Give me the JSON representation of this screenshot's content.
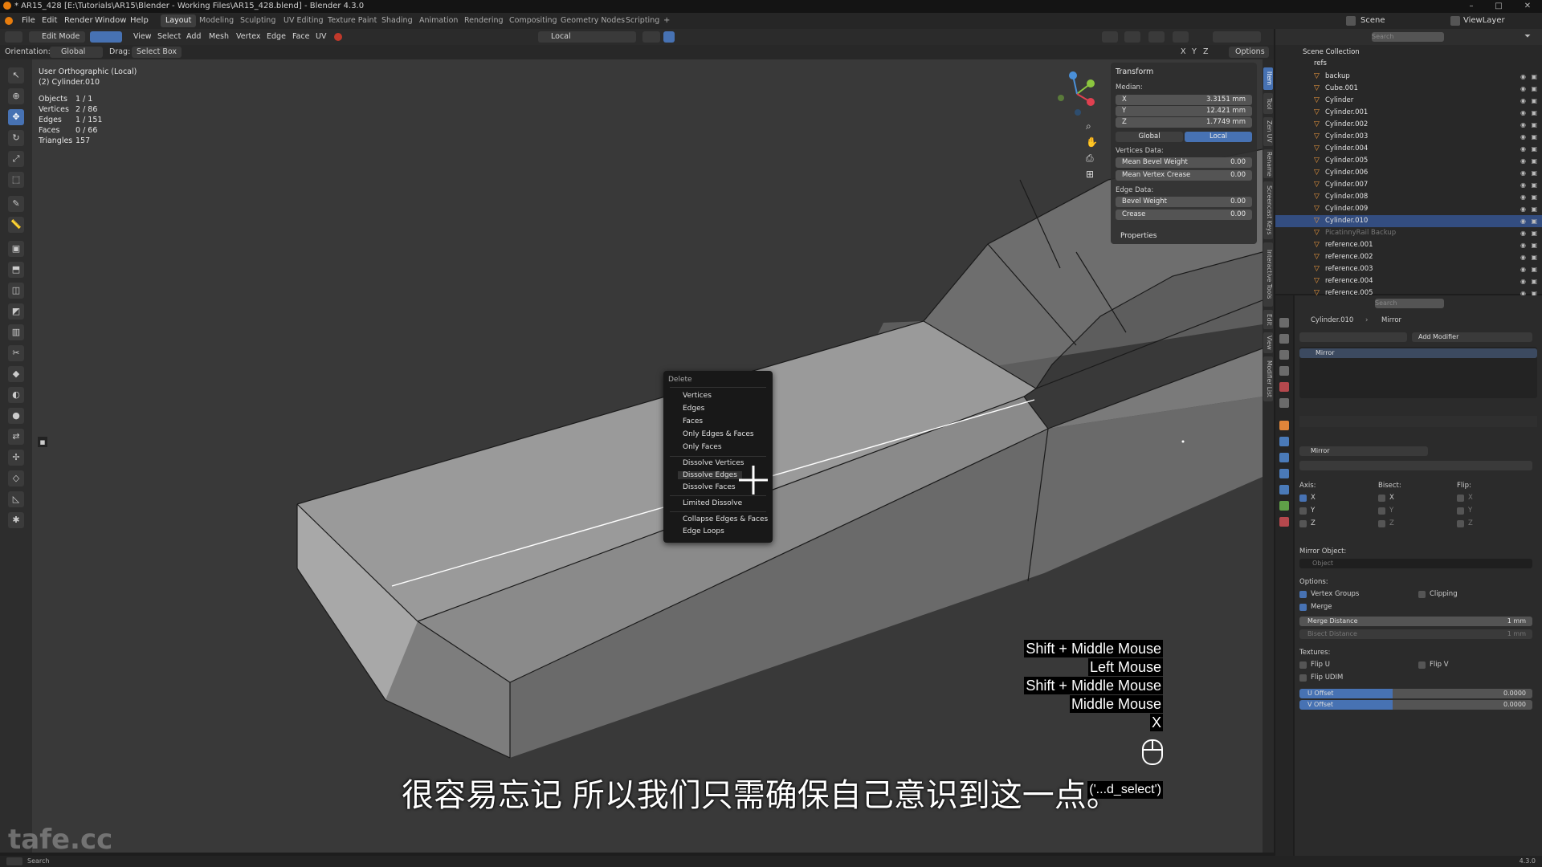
{
  "window": {
    "title": "* AR15_428 [E:\\Tutorials\\AR15\\Blender - Working Files\\AR15_428.blend] - Blender 4.3.0",
    "minimize": "–",
    "maximize": "□",
    "close": "✕"
  },
  "menu": {
    "items": [
      "File",
      "Edit",
      "Render",
      "Window",
      "Help"
    ],
    "workspaces": [
      "Layout",
      "Modeling",
      "Sculpting",
      "UV Editing",
      "Texture Paint",
      "Shading",
      "Animation",
      "Rendering",
      "Compositing",
      "Geometry Nodes",
      "Scripting"
    ],
    "active_workspace": "Layout",
    "add_workspace": "+",
    "scene_label": "Scene",
    "viewlayer_label": "ViewLayer"
  },
  "viewport_header": {
    "mode": "Edit Mode",
    "items": [
      "View",
      "Select",
      "Add",
      "Mesh",
      "Vertex",
      "Edge",
      "Face",
      "UV"
    ],
    "pivot": "Local",
    "options": "Options",
    "xyz": [
      "X",
      "Y",
      "Z"
    ]
  },
  "tool_header": {
    "orientation_label": "Orientation:",
    "orientation_value": "Global",
    "drag_label": "Drag:",
    "drag_value": "Select Box"
  },
  "overlay": {
    "view_name": "User Orthographic (Local)",
    "object_name": "(2) Cylinder.010",
    "stats": [
      {
        "label": "Objects",
        "value": "1 / 1"
      },
      {
        "label": "Vertices",
        "value": "2 / 86"
      },
      {
        "label": "Edges",
        "value": "1 / 151"
      },
      {
        "label": "Faces",
        "value": "0 / 66"
      },
      {
        "label": "Triangles",
        "value": "157"
      }
    ]
  },
  "npanel": {
    "header": "Transform",
    "median_label": "Median:",
    "fields": [
      {
        "label": "X",
        "value": "3.3151 mm"
      },
      {
        "label": "Y",
        "value": "12.421 mm"
      },
      {
        "label": "Z",
        "value": "1.7749 mm"
      }
    ],
    "global_btn": "Global",
    "local_btn": "Local",
    "vertices_data_label": "Vertices Data:",
    "vertex_fields": [
      {
        "label": "Mean Bevel Weight",
        "value": "0.00"
      },
      {
        "label": "Mean Vertex Crease",
        "value": "0.00"
      }
    ],
    "edge_data_label": "Edge Data:",
    "edge_fields": [
      {
        "label": "Bevel Weight",
        "value": "0.00"
      },
      {
        "label": "Crease",
        "value": "0.00"
      }
    ],
    "properties_header": "Properties"
  },
  "side_tabs": [
    "Item",
    "Tool",
    "Zen UV",
    "Rename",
    "Screencast Keys",
    "Interactive Tools",
    "Edit",
    "View",
    "Modifier List"
  ],
  "context_menu": {
    "title": "Delete",
    "items": [
      "Vertices",
      "Edges",
      "Faces",
      "Only Edges & Faces",
      "Only Faces",
      "Dissolve Vertices",
      "Dissolve Edges",
      "Dissolve Faces",
      "Limited Dissolve",
      "Collapse Edges & Faces",
      "Edge Loops"
    ]
  },
  "outliner": {
    "search_placeholder": "Search",
    "collection": "Scene Collection",
    "root": "refs",
    "items": [
      "backup",
      "Cube.001",
      "Cylinder",
      "Cylinder.001",
      "Cylinder.002",
      "Cylinder.003",
      "Cylinder.004",
      "Cylinder.005",
      "Cylinder.006",
      "Cylinder.007",
      "Cylinder.008",
      "Cylinder.009",
      "Cylinder.010",
      "PicatinnyRail Backup",
      "reference.001",
      "reference.002",
      "reference.003",
      "reference.004",
      "reference.005"
    ],
    "selected": "Cylinder.010"
  },
  "properties": {
    "search_placeholder": "Search",
    "breadcrumb_object": "Cylinder.010",
    "breadcrumb_modifier": "Mirror",
    "add_modifier": "Add Modifier",
    "modifier_list_item": "Mirror",
    "modifier_name": "Mirror",
    "axis_label": "Axis:",
    "bisect_label": "Bisect:",
    "flip_label": "Flip:",
    "axes": [
      "X",
      "Y",
      "Z"
    ],
    "mirror_object_label": "Mirror Object:",
    "mirror_object_placeholder": "Object",
    "options_label": "Options:",
    "vertex_groups": "Vertex Groups",
    "clipping": "Clipping",
    "merge": "Merge",
    "merge_distance_label": "Merge Distance",
    "merge_distance_value": "1 mm",
    "bisect_distance_label": "Bisect Distance",
    "bisect_distance_value": "1 mm",
    "textures_label": "Textures:",
    "flip_u": "Flip U",
    "flip_v": "Flip V",
    "flip_udim": "Flip UDIM",
    "u_offset_label": "U Offset",
    "u_offset_value": "0.0000",
    "v_offset_label": "V Offset",
    "v_offset_value": "0.0000"
  },
  "screencast_keys": [
    "Shift + Middle Mouse",
    "Left Mouse",
    "Shift + Middle Mouse",
    "Middle Mouse",
    "X",
    "('...d_select')"
  ],
  "subtitle": "很容易忘记 所以我们只需确保自己意识到这一点。",
  "watermark": "tafe.cc",
  "statusbar": {
    "left": "Search",
    "version": "4.3.0"
  },
  "colors": {
    "accent": "#4772b3",
    "selected_row": "#334d80",
    "object_icon": "#f09a3e"
  }
}
